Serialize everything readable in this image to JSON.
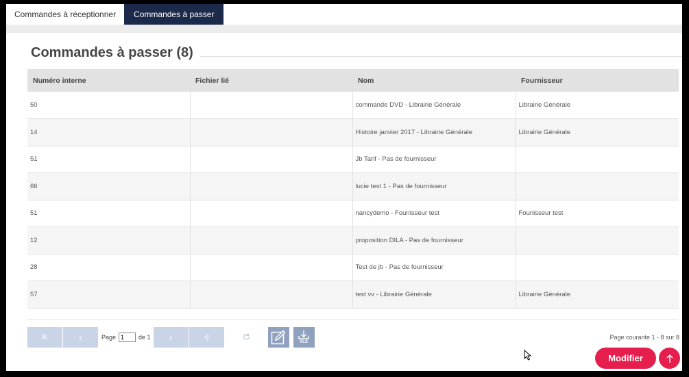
{
  "tabs": [
    {
      "label": "Commandes à réceptionner",
      "active": false
    },
    {
      "label": "Commandes à passer",
      "active": true
    }
  ],
  "page": {
    "title": "Commandes à passer (8)"
  },
  "table": {
    "headers": [
      "Numéro interne",
      "Fichier lié",
      "Nom",
      "Fournisseur"
    ],
    "rows": [
      {
        "numero": "50",
        "fichier": "",
        "nom": "commande DVD - Librairie Générale",
        "fournisseur": "Librairie Générale"
      },
      {
        "numero": "14",
        "fichier": "",
        "nom": "Histoire janvier 2017 - Librairie Générale",
        "fournisseur": "Librairie Générale"
      },
      {
        "numero": "51",
        "fichier": "",
        "nom": "Jb Tarif - Pas de fournisseur",
        "fournisseur": ""
      },
      {
        "numero": "66",
        "fichier": "",
        "nom": "lucie test 1 - Pas de fournisseur",
        "fournisseur": ""
      },
      {
        "numero": "51",
        "fichier": "",
        "nom": "nancydemo - Founisseur test",
        "fournisseur": "Founisseur test"
      },
      {
        "numero": "12",
        "fichier": "",
        "nom": "proposition DILA - Pas de fournisseur",
        "fournisseur": ""
      },
      {
        "numero": "28",
        "fichier": "",
        "nom": "Test de jb - Pas de fournisseur",
        "fournisseur": ""
      },
      {
        "numero": "57",
        "fichier": "",
        "nom": "test vv - Librairie Générale",
        "fournisseur": "Librairie Générale"
      }
    ]
  },
  "pager": {
    "first_icon": "K",
    "prev_icon": "‹",
    "next_icon": "›",
    "last_icon": "›|",
    "page_label": "Page",
    "page_value": "1",
    "of_label": "de 1",
    "refresh_icon": "refresh-icon",
    "edit_icon": "edit-icon",
    "xls_icon": "xls-download-icon",
    "xls_label": "XLS",
    "status": "Page courante 1 - 8 sur 8"
  },
  "actions": {
    "modifier_label": "Modifier",
    "top_icon": "arrow-up-icon"
  },
  "colors": {
    "accent": "#e61e4d",
    "nav_dark": "#1b2a4b",
    "pager_btn": "#c9d5e6",
    "icon_btn": "#8fa1bf"
  }
}
